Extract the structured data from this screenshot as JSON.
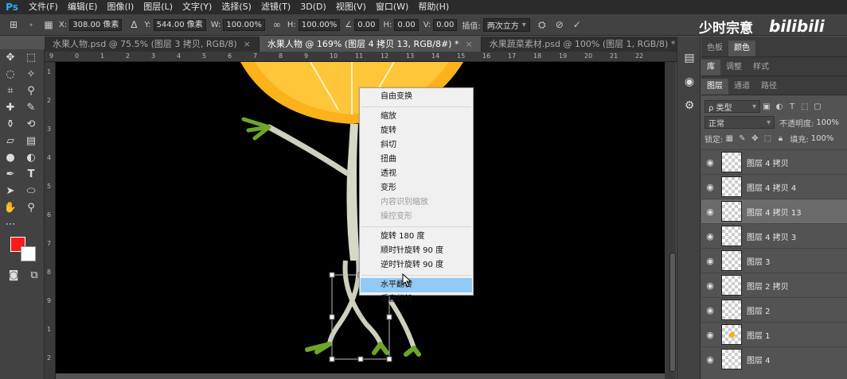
{
  "app": {
    "logo": "Ps"
  },
  "menu": [
    "文件(F)",
    "编辑(E)",
    "图像(I)",
    "图层(L)",
    "文字(Y)",
    "选择(S)",
    "滤镜(T)",
    "3D(D)",
    "视图(V)",
    "窗口(W)",
    "帮助(H)"
  ],
  "options": {
    "x_label": "X:",
    "x_value": "308.00 像素",
    "y_label": "Y:",
    "y_value": "544.00 像素",
    "w_label": "W:",
    "w_value": "100.00%",
    "h_label": "H:",
    "h_value": "100.00%",
    "angle_value": "0.00",
    "hskew_label": "H:",
    "hskew_value": "0.00",
    "vskew_label": "V:",
    "vskew_value": "0.00",
    "interp_label": "插值:",
    "interp_value": "两次立方"
  },
  "watermark": {
    "text": "少时宗意",
    "brand": "bilibili"
  },
  "tabs": [
    {
      "label": "水果人物.psd @ 75.5% (图层 3 拷贝, RGB/8)",
      "close": "×"
    },
    {
      "label": "水果人物 @ 169% (图层 4 拷贝 13, RGB/8#) *",
      "close": "×"
    },
    {
      "label": "水果蔬菜素材.psd @ 100% (图层 1, RGB/8) *",
      "close": "×"
    }
  ],
  "ruler": {
    "top": [
      "9",
      "0",
      "1",
      "2",
      "3",
      "4",
      "5",
      "6",
      "7",
      "8",
      "9",
      "10",
      "11",
      "12",
      "13",
      "14",
      "15",
      "16",
      "17",
      "18",
      "19",
      "20",
      "21",
      "22"
    ],
    "left": [
      "1",
      "2",
      "3",
      "4",
      "5",
      "6",
      "7",
      "8",
      "9",
      "1",
      "2"
    ]
  },
  "context_menu": {
    "group1": [
      "自由变换"
    ],
    "group2": [
      "缩放",
      "旋转",
      "斜切",
      "扭曲",
      "透视",
      "变形"
    ],
    "group2_disabled": [
      "内容识别缩放",
      "操控变形"
    ],
    "group3": [
      "旋转 180 度",
      "顺时针旋转 90 度",
      "逆时针旋转 90 度"
    ],
    "group4_hover": "水平翻转",
    "group4_rest": "垂直翻转"
  },
  "right_panel": {
    "top_tabs": [
      "色板",
      "颜色"
    ],
    "mid_tabs": [
      "库",
      "调整",
      "样式"
    ],
    "layer_tabs": [
      "图层",
      "通道",
      "路径"
    ],
    "filter_kind": "ρ 类型",
    "blend_mode": "正常",
    "opacity_label": "不透明度:",
    "opacity_value": "100%",
    "lock_label": "锁定:",
    "fill_label": "填充:",
    "fill_value": "100%",
    "layers": [
      {
        "name": "图层 4 拷贝",
        "selected": false,
        "dot": false
      },
      {
        "name": "图层 4 拷贝 4",
        "selected": false,
        "dot": false
      },
      {
        "name": "图层 4 拷贝 13",
        "selected": true,
        "dot": false
      },
      {
        "name": "图层 4 拷贝 3",
        "selected": false,
        "dot": false
      },
      {
        "name": "图层 3",
        "selected": false,
        "dot": false
      },
      {
        "name": "图层 2 拷贝",
        "selected": false,
        "dot": false
      },
      {
        "name": "图层 2",
        "selected": false,
        "dot": false
      },
      {
        "name": "图层 1",
        "selected": false,
        "dot": true
      },
      {
        "name": "图层 4",
        "selected": false,
        "dot": false
      }
    ]
  },
  "colors": {
    "foreground": "#ff1a1a",
    "background": "#ffffff",
    "accent": "#31a8ff"
  }
}
